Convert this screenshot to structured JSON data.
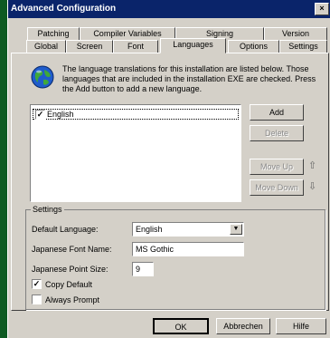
{
  "window": {
    "title": "Advanced Configuration",
    "close_glyph": "×"
  },
  "tabs_row1": [
    "Patching",
    "Compiler Variables",
    "Signing",
    "Version"
  ],
  "tabs_row2": [
    "Global",
    "Screen",
    "Font",
    "Languages",
    "Options",
    "Settings"
  ],
  "active_tab": "Languages",
  "intro_text": "The language translations for this installation are listed below. Those languages that are included in the installation EXE are checked. Press the Add button to add a new language.",
  "languages": [
    {
      "label": "English",
      "checked": true
    }
  ],
  "buttons": {
    "add": "Add",
    "delete": "Delete",
    "move_up": "Move Up",
    "move_down": "Move Down"
  },
  "settings": {
    "group_title": "Settings",
    "default_language_label": "Default Language:",
    "default_language_value": "English",
    "japanese_font_label": "Japanese Font Name:",
    "japanese_font_value": "MS Gothic",
    "japanese_point_label": "Japanese Point Size:",
    "japanese_point_value": "9",
    "copy_default_label": "Copy Default",
    "copy_default_checked": true,
    "always_prompt_label": "Always Prompt",
    "always_prompt_checked": false
  },
  "footer": {
    "ok": "OK",
    "cancel": "Abbrechen",
    "help": "Hilfe"
  },
  "icons": {
    "up_arrow": "⇧",
    "down_arrow": "⇩",
    "dropdown": "▼",
    "check": "✓"
  },
  "colors": {
    "title_bar": "#0a246a",
    "face": "#d4d0c8",
    "background": "#0e5a24"
  }
}
